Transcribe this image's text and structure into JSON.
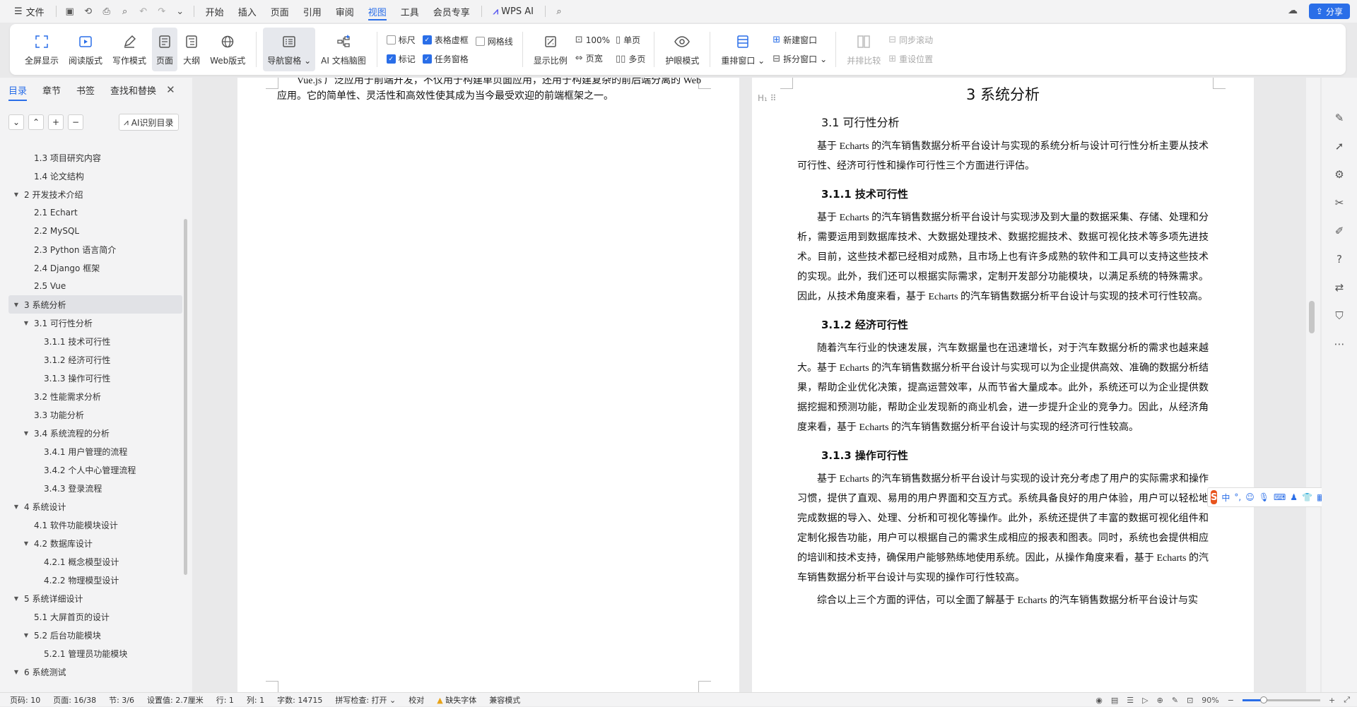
{
  "menubar": {
    "file": "文件",
    "items": [
      "开始",
      "插入",
      "页面",
      "引用",
      "审阅",
      "视图",
      "工具",
      "会员专享"
    ],
    "active": "视图",
    "wps_ai": "WPS AI",
    "share": "分享"
  },
  "toolbar": {
    "view_modes": [
      "全屏显示",
      "阅读版式",
      "写作模式",
      "页面",
      "大纲",
      "Web版式"
    ],
    "nav_pane": "导航窗格",
    "ai_mindmap": "AI 文档脑图",
    "checks": [
      {
        "label": "标尺",
        "checked": false
      },
      {
        "label": "表格虚框",
        "checked": true
      },
      {
        "label": "网格线",
        "checked": false
      },
      {
        "label": "标记",
        "checked": true
      },
      {
        "label": "任务窗格",
        "checked": true
      }
    ],
    "display_ratio": "显示比例",
    "zoom_100": "100%",
    "page_width": "页宽",
    "single_page": "单页",
    "multi_page": "多页",
    "eye_mode": "护眼模式",
    "rearrange_window": "重排窗口",
    "new_window": "新建窗口",
    "split_window": "拆分窗口",
    "side_by_side": "并排比较",
    "sync_scroll": "同步滚动",
    "reset_position": "重设位置"
  },
  "sidebar": {
    "tabs": [
      "目录",
      "章节",
      "书签",
      "查找和替换"
    ],
    "ai_toc": "AI识别目录",
    "toc": [
      {
        "label": "1.3 项目研究内容",
        "level": 2,
        "toggle": ""
      },
      {
        "label": "1.4 论文结构",
        "level": 2,
        "toggle": ""
      },
      {
        "label": "2 开发技术介绍",
        "level": 1,
        "toggle": "▼"
      },
      {
        "label": "2.1 Echart",
        "level": 2,
        "toggle": ""
      },
      {
        "label": "2.2 MySQL",
        "level": 2,
        "toggle": ""
      },
      {
        "label": "2.3 Python 语言简介",
        "level": 2,
        "toggle": ""
      },
      {
        "label": "2.4 Django 框架",
        "level": 2,
        "toggle": ""
      },
      {
        "label": "2.5 Vue",
        "level": 2,
        "toggle": ""
      },
      {
        "label": "3 系统分析",
        "level": 1,
        "toggle": "▼",
        "selected": true
      },
      {
        "label": "3.1 可行性分析",
        "level": 2,
        "toggle": "▼"
      },
      {
        "label": "3.1.1 技术可行性",
        "level": 3,
        "toggle": ""
      },
      {
        "label": "3.1.2 经济可行性",
        "level": 3,
        "toggle": ""
      },
      {
        "label": "3.1.3 操作可行性",
        "level": 3,
        "toggle": ""
      },
      {
        "label": "3.2 性能需求分析",
        "level": 2,
        "toggle": ""
      },
      {
        "label": "3.3 功能分析",
        "level": 2,
        "toggle": ""
      },
      {
        "label": "3.4 系统流程的分析",
        "level": 2,
        "toggle": "▼"
      },
      {
        "label": "3.4.1  用户管理的流程",
        "level": 3,
        "toggle": ""
      },
      {
        "label": "3.4.2  个人中心管理流程",
        "level": 3,
        "toggle": ""
      },
      {
        "label": "3.4.3  登录流程",
        "level": 3,
        "toggle": ""
      },
      {
        "label": "4 系统设计",
        "level": 1,
        "toggle": "▼"
      },
      {
        "label": "4.1  软件功能模块设计",
        "level": 2,
        "toggle": ""
      },
      {
        "label": "4.2  数据库设计",
        "level": 2,
        "toggle": "▼"
      },
      {
        "label": "4.2.1  概念模型设计",
        "level": 3,
        "toggle": ""
      },
      {
        "label": "4.2.2  物理模型设计",
        "level": 3,
        "toggle": ""
      },
      {
        "label": "5 系统详细设计",
        "level": 1,
        "toggle": "▼"
      },
      {
        "label": "5.1 大屏首页的设计",
        "level": 2,
        "toggle": ""
      },
      {
        "label": "5.2 后台功能模块",
        "level": 2,
        "toggle": "▼"
      },
      {
        "label": "5.2.1 管理员功能模块",
        "level": 3,
        "toggle": ""
      },
      {
        "label": "6 系统测试",
        "level": 1,
        "toggle": "▼"
      }
    ]
  },
  "doc": {
    "left_page_text": "Vue.js 广泛应用于前端开发，不仅用于构建单页面应用，还用于构建复杂的前后端分离的 Web 应用。它的简单性、灵活性和高效性使其成为当今最受欢迎的前端框架之一。",
    "chapter_title": "3 系统分析",
    "sec_31": "3.1 可行性分析",
    "p_31": "基于 Echarts 的汽车销售数据分析平台设计与实现的系统分析与设计可行性分析主要从技术可行性、经济可行性和操作可行性三个方面进行评估。",
    "sec_311": "3.1.1 技术可行性",
    "p_311": "基于 Echarts 的汽车销售数据分析平台设计与实现涉及到大量的数据采集、存储、处理和分析，需要运用到数据库技术、大数据处理技术、数据挖掘技术、数据可视化技术等多项先进技术。目前，这些技术都已经相对成熟，且市场上也有许多成熟的软件和工具可以支持这些技术的实现。此外，我们还可以根据实际需求，定制开发部分功能模块，以满足系统的特殊需求。因此，从技术角度来看，基于 Echarts 的汽车销售数据分析平台设计与实现的技术可行性较高。",
    "sec_312": "3.1.2 经济可行性",
    "p_312": "随着汽车行业的快速发展，汽车数据量也在迅速增长，对于汽车数据分析的需求也越来越大。基于 Echarts 的汽车销售数据分析平台设计与实现可以为企业提供高效、准确的数据分析结果，帮助企业优化决策，提高运营效率，从而节省大量成本。此外，系统还可以为企业提供数据挖掘和预测功能，帮助企业发现新的商业机会，进一步提升企业的竞争力。因此，从经济角度来看，基于 Echarts 的汽车销售数据分析平台设计与实现的经济可行性较高。",
    "sec_313": "3.1.3 操作可行性",
    "p_313": "基于 Echarts 的汽车销售数据分析平台设计与实现的设计充分考虑了用户的实际需求和操作习惯，提供了直观、易用的用户界面和交互方式。系统具备良好的用户体验，用户可以轻松地完成数据的导入、处理、分析和可视化等操作。此外，系统还提供了丰富的数据可视化组件和定制化报告功能，用户可以根据自己的需求生成相应的报表和图表。同时，系统也会提供相应的培训和技术支持，确保用户能够熟练地使用系统。因此，从操作角度来看，基于 Echarts 的汽车销售数据分析平台设计与实现的操作可行性较高。",
    "p_last": "综合以上三个方面的评估，可以全面了解基于 Echarts 的汽车销售数据分析平台设计与实"
  },
  "ime": {
    "lang": "中"
  },
  "status": {
    "page": "页码: 10",
    "pages": "页面: 16/38",
    "section": "节: 3/6",
    "setting": "设置值: 2.7厘米",
    "row": "行: 1",
    "col": "列: 1",
    "words": "字数: 14715",
    "spell": "拼写检查: 打开",
    "proof": "校对",
    "missing_font": "缺失字体",
    "compat": "兼容模式",
    "zoom": "90%",
    "zoom_level": 0.9
  }
}
